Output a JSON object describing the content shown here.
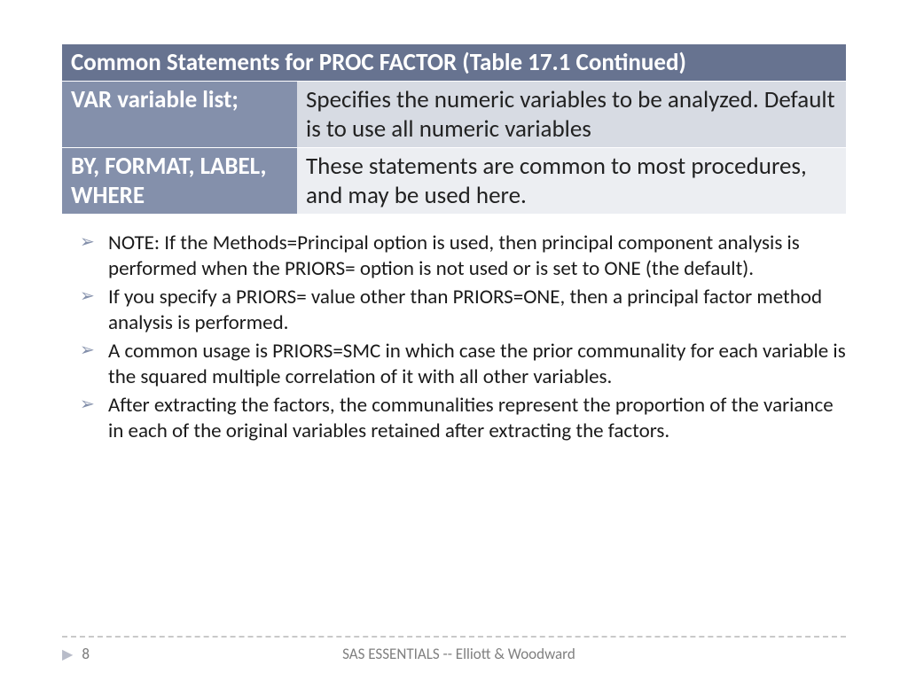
{
  "table": {
    "header": "Common Statements for PROC FACTOR (Table 17.1 Continued)",
    "rows": [
      {
        "left": "VAR variable list;",
        "right": "Specifies the numeric variables to be analyzed. Default is to use all numeric variables"
      },
      {
        "left": "BY, FORMAT, LABEL, WHERE",
        "right": "These statements are common to most procedures, and may be used here."
      }
    ]
  },
  "notes": [
    "NOTE: If the Methods=Principal option is used, then principal component analysis is performed when the PRIORS= option is not used or is set to ONE (the default).",
    "If you specify a PRIORS= value other than PRIORS=ONE, then a principal factor method analysis is performed.",
    "A common usage is PRIORS=SMC in which case the prior communality for each variable is the squared multiple correlation of it with all other variables.",
    "After extracting the factors, the communalities represent the proportion of the variance in each of the original variables retained after extracting the factors."
  ],
  "footer": {
    "page": "8",
    "title": "SAS ESSENTIALS -- Elliott & Woodward"
  }
}
